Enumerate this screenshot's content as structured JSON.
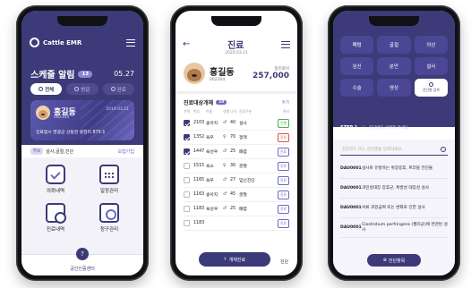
{
  "phone1": {
    "brand": "Cattle EMR",
    "schedule_title": "스케줄 알림",
    "schedule_count": "13",
    "date": "05.27",
    "filters": [
      {
        "label": "전체",
        "active": true
      },
      {
        "label": "방문",
        "active": false
      },
      {
        "label": "완료",
        "active": false
      }
    ],
    "card": {
      "name": "홍길동",
      "id": "002304",
      "right_text": "2019.03.21",
      "address": "진료일시 영광군 산동면 봉현리 875-1"
    },
    "mid": {
      "tag": "무소",
      "text": "설사,골절,진단",
      "link": "보험가입"
    },
    "menu": [
      {
        "label": "의뢰내역",
        "icon": "clipboard-check-icon"
      },
      {
        "label": "일정관리",
        "icon": "calendar-icon"
      },
      {
        "label": "진료내역",
        "icon": "history-icon"
      },
      {
        "label": "청구관리",
        "icon": "claim-icon"
      }
    ],
    "bottom_label": "공인인증센터"
  },
  "phone2": {
    "title": "진료",
    "date": "2020.03.21",
    "patient": {
      "name": "홍길동",
      "id": "002304",
      "amount_label": "총진료비",
      "amount": "257,000"
    },
    "section_title": "진료대상개체",
    "section_count": "10",
    "section_link": "추가",
    "columns": [
      "선택",
      "번호",
      "이름",
      "성별",
      "나이",
      "진료구분",
      "관리"
    ],
    "rows": [
      {
        "checked": true,
        "code": "2103",
        "name": "송아지",
        "sex": "♂",
        "age": "40",
        "cat": "설사",
        "pill": "진행",
        "pill_color": "green"
      },
      {
        "checked": true,
        "code": "1352",
        "name": "육우",
        "sex": "♀",
        "age": "70",
        "cat": "정맥",
        "pill": "진료",
        "pill_color": "red"
      },
      {
        "checked": true,
        "code": "1447",
        "name": "육성우",
        "sex": "♂",
        "age": "25",
        "cat": "폐렴",
        "pill": "진료",
        "pill_color": ""
      },
      {
        "checked": false,
        "code": "1515",
        "name": "육소",
        "sex": "♀",
        "age": "30",
        "cat": "골절",
        "pill": "진료",
        "pill_color": ""
      },
      {
        "checked": false,
        "code": "1165",
        "name": "육우",
        "sex": "♂",
        "age": "27",
        "cat": "임신진단",
        "pill": "진료",
        "pill_color": ""
      },
      {
        "checked": false,
        "code": "1163",
        "name": "송아지",
        "sex": "♂",
        "age": "45",
        "cat": "골절",
        "pill": "진료",
        "pill_color": ""
      },
      {
        "checked": false,
        "code": "1183",
        "name": "육성우",
        "sex": "♂",
        "age": "25",
        "cat": "폐렴",
        "pill": "진료",
        "pill_color": ""
      },
      {
        "checked": false,
        "code": "1183",
        "name": "",
        "sex": "",
        "age": "",
        "cat": "",
        "pill": "진료",
        "pill_color": ""
      }
    ],
    "cta": "개체진료",
    "cta_side": "진단"
  },
  "phone3": {
    "categories": [
      {
        "label": "폐렴",
        "selected": false
      },
      {
        "label": "골절",
        "selected": false
      },
      {
        "label": "외상",
        "selected": false
      },
      {
        "label": "임신",
        "selected": false
      },
      {
        "label": "분만",
        "selected": false
      },
      {
        "label": "설사",
        "selected": false
      },
      {
        "label": "수술",
        "selected": false
      },
      {
        "label": "영상",
        "selected": false
      },
      {
        "label": "진단명 검색",
        "selected": true
      }
    ],
    "step_label": "STEP 1",
    "step_text": "진단명을 선택해 주세요.",
    "search_placeholder": "진단코드 또는 진단명을 입력하세요.",
    "items": [
      {
        "code": "DAU0001",
        "desc": "설사로 유발하는 위장증후, 트러블 전단을"
      },
      {
        "code": "DAU0001",
        "desc": "과민성대장 증후군, 특발성 대장성 설사"
      },
      {
        "code": "DAU0001",
        "desc": "서류 과잉급여 또는 변화로 인한 설사"
      },
      {
        "code": "DAU0001",
        "desc": "Clostridium perfringens (웰치균)에 연관된 설사"
      }
    ],
    "cta": "진단항목"
  },
  "colors": {
    "primary": "#3c3a78",
    "accent": "#6b68c2"
  }
}
